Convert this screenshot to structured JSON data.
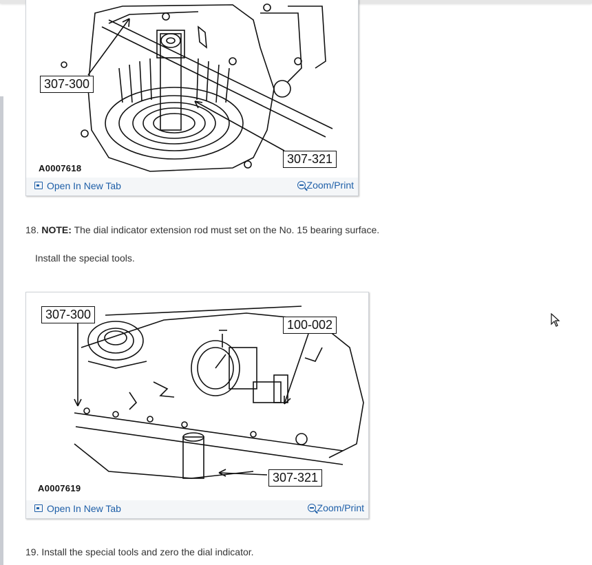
{
  "figures": [
    {
      "id": "A0007618",
      "callouts": [
        "307-300",
        "307-321"
      ],
      "open_label": "Open In New Tab",
      "zoom_label": "Zoom/Print"
    },
    {
      "id": "A0007619",
      "callouts": [
        "307-300",
        "100-002",
        "307-321"
      ],
      "open_label": "Open In New Tab",
      "zoom_label": "Zoom/Print"
    }
  ],
  "steps": [
    {
      "number": "18.",
      "note_label": "NOTE:",
      "note_text": "The dial indicator extension rod must set on the No. 15 bearing surface.",
      "sub_text": "Install the special tools."
    },
    {
      "number": "19.",
      "text": "Install the special tools and zero the dial indicator."
    }
  ],
  "icons": [
    "open-new-tab-icon",
    "zoom-icon",
    "mouse-cursor-icon"
  ],
  "colors": {
    "link": "#1e5fa8",
    "footer_bg": "#f4f6f8",
    "border": "#cfd3d8"
  }
}
